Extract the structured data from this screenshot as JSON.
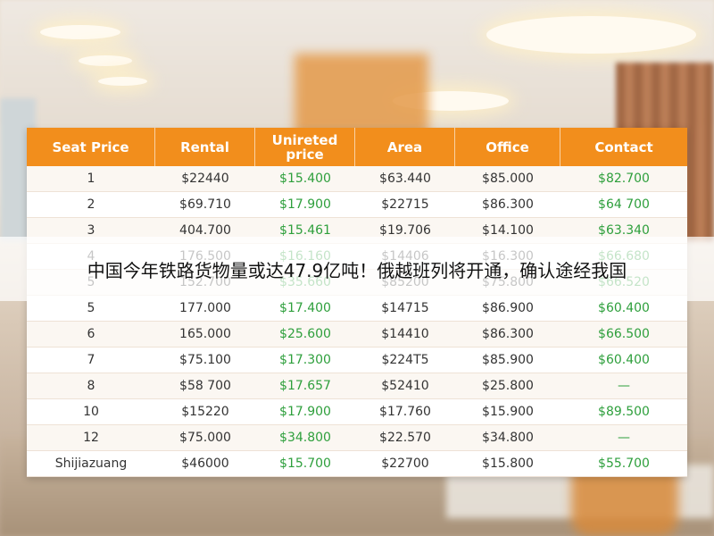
{
  "table": {
    "headers": [
      "Seat Price",
      "Rental",
      "Unireted price",
      "Area",
      "Office",
      "Contact"
    ],
    "rows": [
      [
        "1",
        "$22440",
        "$15.400",
        "$63.440",
        "$85.000",
        "$82.700"
      ],
      [
        "2",
        "$69.710",
        "$17.900",
        "$22715",
        "$86.300",
        "$64 700"
      ],
      [
        "3",
        "404.700",
        "$15.461",
        "$19.706",
        "$14.100",
        "$63.340"
      ],
      [
        "4",
        "176.500",
        "$16.160",
        "$14406",
        "$16.300",
        "$66.680"
      ],
      [
        "5",
        "152.700",
        "$35.660",
        "$85200",
        "$75.800",
        "$66.520"
      ],
      [
        "5",
        "177.000",
        "$17.400",
        "$14715",
        "$86.900",
        "$60.400"
      ],
      [
        "6",
        "165.000",
        "$25.600",
        "$14410",
        "$86.300",
        "$66.500"
      ],
      [
        "7",
        "$75.100",
        "$17.300",
        "$224T5",
        "$85.900",
        "$60.400"
      ],
      [
        "8",
        "$58 700",
        "$17.657",
        "$52410",
        "$25.800",
        "—"
      ],
      [
        "10",
        "$15220",
        "$17.900",
        "$17.760",
        "$15.900",
        "$89.500"
      ],
      [
        "12",
        "$75.000",
        "$34.800",
        "$22.570",
        "$34.800",
        "—"
      ],
      [
        "Shijiazuang",
        "$46000",
        "$15.700",
        "$22700",
        "$15.800",
        "$55.700"
      ]
    ]
  },
  "caption": "中国今年铁路货物量或达47.9亿吨！俄越班列将开通，确认途经我国",
  "colors": {
    "header": "#f28e1c",
    "green": "#2e9f3c"
  }
}
